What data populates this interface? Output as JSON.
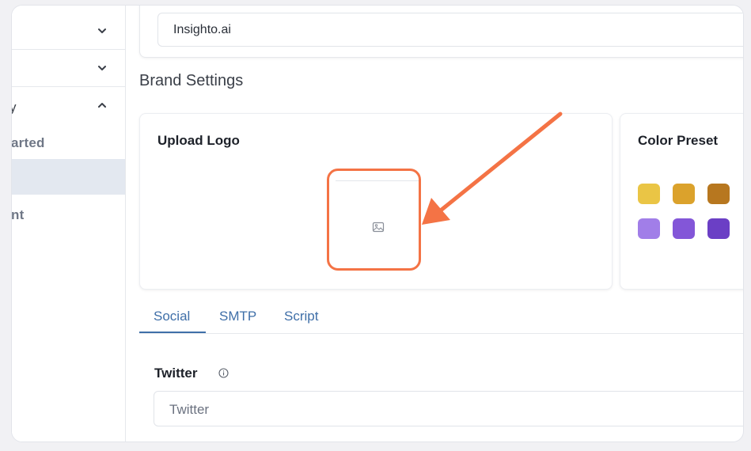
{
  "sidebar": {
    "items": [
      {
        "icon": "chevron-down-icon"
      },
      {
        "icon": "chevron-down-icon"
      },
      {
        "label": "y",
        "icon": "chevron-up-icon"
      }
    ],
    "subitems": [
      "arted",
      "",
      "nt"
    ]
  },
  "site": {
    "name_value": "Insighto.ai"
  },
  "brand": {
    "title": "Brand Settings",
    "upload_title": "Upload Logo",
    "color_title": "Color Preset",
    "placeholder_icon": "image-icon",
    "swatches": [
      "#eac545",
      "#dba22c",
      "#b7771f",
      "#a17ee8",
      "#8356d8",
      "#6b3fc5"
    ]
  },
  "annotation": {
    "color": "#f47345"
  },
  "tabs": [
    {
      "label": "Social",
      "active": true
    },
    {
      "label": "SMTP",
      "active": false
    },
    {
      "label": "Script",
      "active": false
    }
  ],
  "twitter": {
    "label": "Twitter",
    "placeholder": "Twitter",
    "info_icon": "info-icon"
  }
}
